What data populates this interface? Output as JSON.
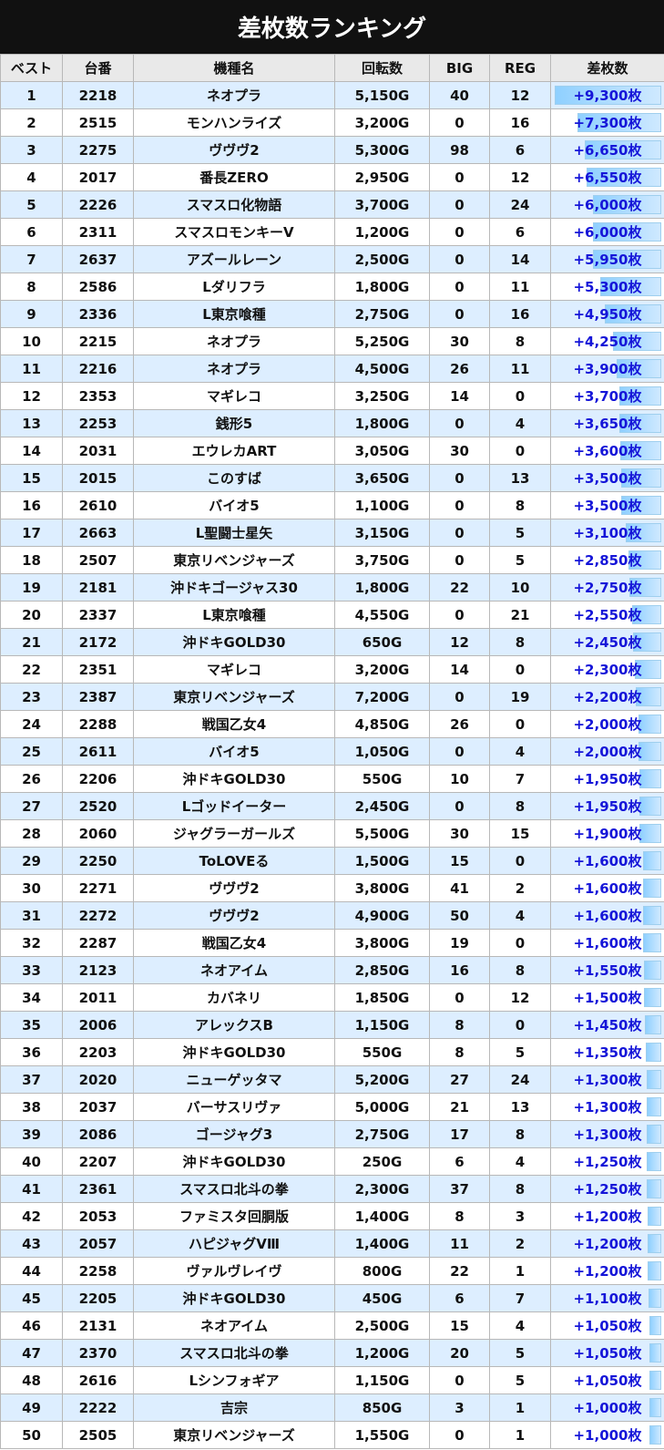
{
  "title": "差枚数ランキング",
  "headers": [
    "ベスト",
    "台番",
    "機種名",
    "回転数",
    "BIG",
    "REG",
    "差枚数"
  ],
  "max_diff": 9300,
  "rows": [
    {
      "rank": "1",
      "machine": "2218",
      "name": "ネオプラ",
      "spins": "5,150G",
      "big": "40",
      "reg": "12",
      "diff": "+9,300枚",
      "diff_value": 9300
    },
    {
      "rank": "2",
      "machine": "2515",
      "name": "モンハンライズ",
      "spins": "3,200G",
      "big": "0",
      "reg": "16",
      "diff": "+7,300枚",
      "diff_value": 7300
    },
    {
      "rank": "3",
      "machine": "2275",
      "name": "ヴヴヴ2",
      "spins": "5,300G",
      "big": "98",
      "reg": "6",
      "diff": "+6,650枚",
      "diff_value": 6650
    },
    {
      "rank": "4",
      "machine": "2017",
      "name": "番長ZERO",
      "spins": "2,950G",
      "big": "0",
      "reg": "12",
      "diff": "+6,550枚",
      "diff_value": 6550
    },
    {
      "rank": "5",
      "machine": "2226",
      "name": "スマスロ化物語",
      "spins": "3,700G",
      "big": "0",
      "reg": "24",
      "diff": "+6,000枚",
      "diff_value": 6000
    },
    {
      "rank": "6",
      "machine": "2311",
      "name": "スマスロモンキーV",
      "spins": "1,200G",
      "big": "0",
      "reg": "6",
      "diff": "+6,000枚",
      "diff_value": 6000
    },
    {
      "rank": "7",
      "machine": "2637",
      "name": "アズールレーン",
      "spins": "2,500G",
      "big": "0",
      "reg": "14",
      "diff": "+5,950枚",
      "diff_value": 5950
    },
    {
      "rank": "8",
      "machine": "2586",
      "name": "Lダリフラ",
      "spins": "1,800G",
      "big": "0",
      "reg": "11",
      "diff": "+5,300枚",
      "diff_value": 5300
    },
    {
      "rank": "9",
      "machine": "2336",
      "name": "L東京喰種",
      "spins": "2,750G",
      "big": "0",
      "reg": "16",
      "diff": "+4,950枚",
      "diff_value": 4950
    },
    {
      "rank": "10",
      "machine": "2215",
      "name": "ネオプラ",
      "spins": "5,250G",
      "big": "30",
      "reg": "8",
      "diff": "+4,250枚",
      "diff_value": 4250
    },
    {
      "rank": "11",
      "machine": "2216",
      "name": "ネオプラ",
      "spins": "4,500G",
      "big": "26",
      "reg": "11",
      "diff": "+3,900枚",
      "diff_value": 3900
    },
    {
      "rank": "12",
      "machine": "2353",
      "name": "マギレコ",
      "spins": "3,250G",
      "big": "14",
      "reg": "0",
      "diff": "+3,700枚",
      "diff_value": 3700
    },
    {
      "rank": "13",
      "machine": "2253",
      "name": "銭形5",
      "spins": "1,800G",
      "big": "0",
      "reg": "4",
      "diff": "+3,650枚",
      "diff_value": 3650
    },
    {
      "rank": "14",
      "machine": "2031",
      "name": "エウレカART",
      "spins": "3,050G",
      "big": "30",
      "reg": "0",
      "diff": "+3,600枚",
      "diff_value": 3600
    },
    {
      "rank": "15",
      "machine": "2015",
      "name": "このすば",
      "spins": "3,650G",
      "big": "0",
      "reg": "13",
      "diff": "+3,500枚",
      "diff_value": 3500
    },
    {
      "rank": "16",
      "machine": "2610",
      "name": "バイオ5",
      "spins": "1,100G",
      "big": "0",
      "reg": "8",
      "diff": "+3,500枚",
      "diff_value": 3500
    },
    {
      "rank": "17",
      "machine": "2663",
      "name": "L聖闘士星矢",
      "spins": "3,150G",
      "big": "0",
      "reg": "5",
      "diff": "+3,100枚",
      "diff_value": 3100
    },
    {
      "rank": "18",
      "machine": "2507",
      "name": "東京リベンジャーズ",
      "spins": "3,750G",
      "big": "0",
      "reg": "5",
      "diff": "+2,850枚",
      "diff_value": 2850
    },
    {
      "rank": "19",
      "machine": "2181",
      "name": "沖ドキゴージャス30",
      "spins": "1,800G",
      "big": "22",
      "reg": "10",
      "diff": "+2,750枚",
      "diff_value": 2750
    },
    {
      "rank": "20",
      "machine": "2337",
      "name": "L東京喰種",
      "spins": "4,550G",
      "big": "0",
      "reg": "21",
      "diff": "+2,550枚",
      "diff_value": 2550
    },
    {
      "rank": "21",
      "machine": "2172",
      "name": "沖ドキGOLD30",
      "spins": "650G",
      "big": "12",
      "reg": "8",
      "diff": "+2,450枚",
      "diff_value": 2450
    },
    {
      "rank": "22",
      "machine": "2351",
      "name": "マギレコ",
      "spins": "3,200G",
      "big": "14",
      "reg": "0",
      "diff": "+2,300枚",
      "diff_value": 2300
    },
    {
      "rank": "23",
      "machine": "2387",
      "name": "東京リベンジャーズ",
      "spins": "7,200G",
      "big": "0",
      "reg": "19",
      "diff": "+2,200枚",
      "diff_value": 2200
    },
    {
      "rank": "24",
      "machine": "2288",
      "name": "戦国乙女4",
      "spins": "4,850G",
      "big": "26",
      "reg": "0",
      "diff": "+2,000枚",
      "diff_value": 2000
    },
    {
      "rank": "25",
      "machine": "2611",
      "name": "バイオ5",
      "spins": "1,050G",
      "big": "0",
      "reg": "4",
      "diff": "+2,000枚",
      "diff_value": 2000
    },
    {
      "rank": "26",
      "machine": "2206",
      "name": "沖ドキGOLD30",
      "spins": "550G",
      "big": "10",
      "reg": "7",
      "diff": "+1,950枚",
      "diff_value": 1950
    },
    {
      "rank": "27",
      "machine": "2520",
      "name": "Lゴッドイーター",
      "spins": "2,450G",
      "big": "0",
      "reg": "8",
      "diff": "+1,950枚",
      "diff_value": 1950
    },
    {
      "rank": "28",
      "machine": "2060",
      "name": "ジャグラーガールズ",
      "spins": "5,500G",
      "big": "30",
      "reg": "15",
      "diff": "+1,900枚",
      "diff_value": 1900
    },
    {
      "rank": "29",
      "machine": "2250",
      "name": "ToLOVEる",
      "spins": "1,500G",
      "big": "15",
      "reg": "0",
      "diff": "+1,600枚",
      "diff_value": 1600
    },
    {
      "rank": "30",
      "machine": "2271",
      "name": "ヴヴヴ2",
      "spins": "3,800G",
      "big": "41",
      "reg": "2",
      "diff": "+1,600枚",
      "diff_value": 1600
    },
    {
      "rank": "31",
      "machine": "2272",
      "name": "ヴヴヴ2",
      "spins": "4,900G",
      "big": "50",
      "reg": "4",
      "diff": "+1,600枚",
      "diff_value": 1600
    },
    {
      "rank": "32",
      "machine": "2287",
      "name": "戦国乙女4",
      "spins": "3,800G",
      "big": "19",
      "reg": "0",
      "diff": "+1,600枚",
      "diff_value": 1600
    },
    {
      "rank": "33",
      "machine": "2123",
      "name": "ネオアイム",
      "spins": "2,850G",
      "big": "16",
      "reg": "8",
      "diff": "+1,550枚",
      "diff_value": 1550
    },
    {
      "rank": "34",
      "machine": "2011",
      "name": "カバネリ",
      "spins": "1,850G",
      "big": "0",
      "reg": "12",
      "diff": "+1,500枚",
      "diff_value": 1500
    },
    {
      "rank": "35",
      "machine": "2006",
      "name": "アレックスB",
      "spins": "1,150G",
      "big": "8",
      "reg": "0",
      "diff": "+1,450枚",
      "diff_value": 1450
    },
    {
      "rank": "36",
      "machine": "2203",
      "name": "沖ドキGOLD30",
      "spins": "550G",
      "big": "8",
      "reg": "5",
      "diff": "+1,350枚",
      "diff_value": 1350
    },
    {
      "rank": "37",
      "machine": "2020",
      "name": "ニューゲッタマ",
      "spins": "5,200G",
      "big": "27",
      "reg": "24",
      "diff": "+1,300枚",
      "diff_value": 1300
    },
    {
      "rank": "38",
      "machine": "2037",
      "name": "バーサスリヴァ",
      "spins": "5,000G",
      "big": "21",
      "reg": "13",
      "diff": "+1,300枚",
      "diff_value": 1300
    },
    {
      "rank": "39",
      "machine": "2086",
      "name": "ゴージャグ3",
      "spins": "2,750G",
      "big": "17",
      "reg": "8",
      "diff": "+1,300枚",
      "diff_value": 1300
    },
    {
      "rank": "40",
      "machine": "2207",
      "name": "沖ドキGOLD30",
      "spins": "250G",
      "big": "6",
      "reg": "4",
      "diff": "+1,250枚",
      "diff_value": 1250
    },
    {
      "rank": "41",
      "machine": "2361",
      "name": "スマスロ北斗の拳",
      "spins": "2,300G",
      "big": "37",
      "reg": "8",
      "diff": "+1,250枚",
      "diff_value": 1250
    },
    {
      "rank": "42",
      "machine": "2053",
      "name": "ファミスタ回胴版",
      "spins": "1,400G",
      "big": "8",
      "reg": "3",
      "diff": "+1,200枚",
      "diff_value": 1200
    },
    {
      "rank": "43",
      "machine": "2057",
      "name": "ハピジャグVⅢ",
      "spins": "1,400G",
      "big": "11",
      "reg": "2",
      "diff": "+1,200枚",
      "diff_value": 1200
    },
    {
      "rank": "44",
      "machine": "2258",
      "name": "ヴァルヴレイヴ",
      "spins": "800G",
      "big": "22",
      "reg": "1",
      "diff": "+1,200枚",
      "diff_value": 1200
    },
    {
      "rank": "45",
      "machine": "2205",
      "name": "沖ドキGOLD30",
      "spins": "450G",
      "big": "6",
      "reg": "7",
      "diff": "+1,100枚",
      "diff_value": 1100
    },
    {
      "rank": "46",
      "machine": "2131",
      "name": "ネオアイム",
      "spins": "2,500G",
      "big": "15",
      "reg": "4",
      "diff": "+1,050枚",
      "diff_value": 1050
    },
    {
      "rank": "47",
      "machine": "2370",
      "name": "スマスロ北斗の拳",
      "spins": "1,200G",
      "big": "20",
      "reg": "5",
      "diff": "+1,050枚",
      "diff_value": 1050
    },
    {
      "rank": "48",
      "machine": "2616",
      "name": "Lシンフォギア",
      "spins": "1,150G",
      "big": "0",
      "reg": "5",
      "diff": "+1,050枚",
      "diff_value": 1050
    },
    {
      "rank": "49",
      "machine": "2222",
      "name": "吉宗",
      "spins": "850G",
      "big": "3",
      "reg": "1",
      "diff": "+1,000枚",
      "diff_value": 1000
    },
    {
      "rank": "50",
      "machine": "2505",
      "name": "東京リベンジャーズ",
      "spins": "1,550G",
      "big": "0",
      "reg": "1",
      "diff": "+1,000枚",
      "diff_value": 1000
    }
  ]
}
